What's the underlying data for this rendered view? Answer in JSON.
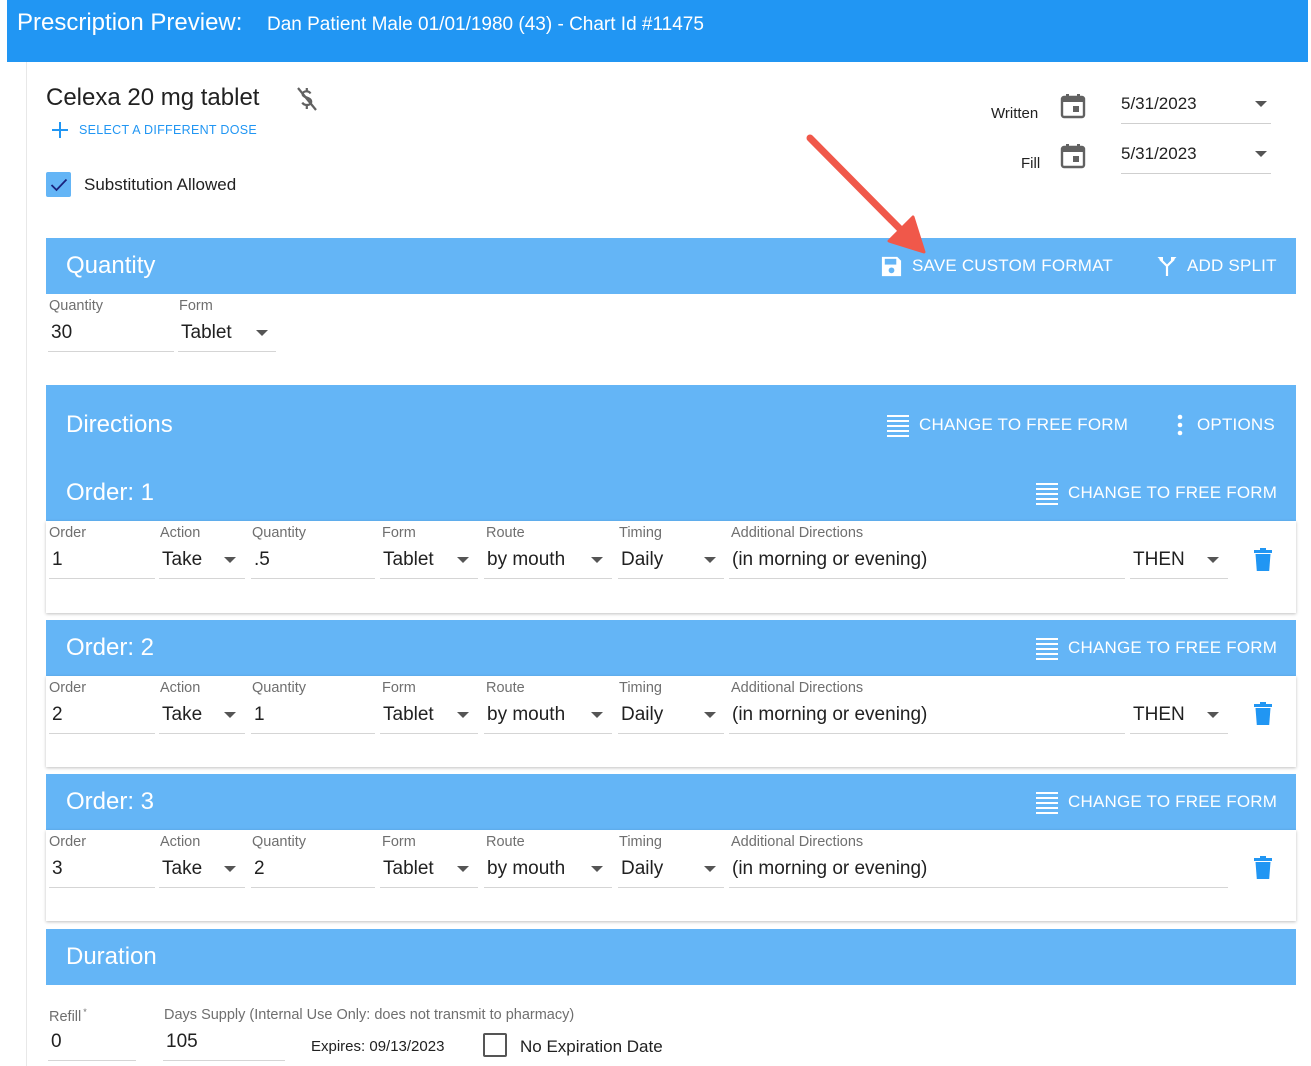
{
  "header": {
    "title": "Prescription Preview:",
    "patient": "Dan Patient Male 01/01/1980 (43) - Chart Id #11475"
  },
  "drug": {
    "name": "Celexa 20 mg tablet",
    "select_dose_label": "SELECT A DIFFERENT DOSE",
    "substitution_label": "Substitution Allowed",
    "substitution_checked": true
  },
  "dates": {
    "written_label": "Written",
    "written_value": "5/31/2023",
    "fill_label": "Fill",
    "fill_value": "5/31/2023"
  },
  "quantity_section": {
    "title": "Quantity",
    "save_custom_label": "SAVE CUSTOM FORMAT",
    "add_split_label": "ADD SPLIT",
    "quantity_label": "Quantity",
    "quantity_value": "30",
    "form_label": "Form",
    "form_value": "Tablet"
  },
  "directions": {
    "title": "Directions",
    "change_free_form_label": "CHANGE TO FREE FORM",
    "options_label": "OPTIONS",
    "column_labels": {
      "order": "Order",
      "action": "Action",
      "quantity": "Quantity",
      "form": "Form",
      "route": "Route",
      "timing": "Timing",
      "additional": "Additional Directions"
    },
    "orders": [
      {
        "title": "Order: 1",
        "change_label": "CHANGE TO FREE FORM",
        "order": "1",
        "action": "Take",
        "quantity": ".5",
        "form": "Tablet",
        "route": "by mouth",
        "timing": "Daily",
        "additional": "(in morning or evening)",
        "then": "THEN"
      },
      {
        "title": "Order: 2",
        "change_label": "CHANGE TO FREE FORM",
        "order": "2",
        "action": "Take",
        "quantity": "1",
        "form": "Tablet",
        "route": "by mouth",
        "timing": "Daily",
        "additional": "(in morning or evening)",
        "then": "THEN"
      },
      {
        "title": "Order: 3",
        "change_label": "CHANGE TO FREE FORM",
        "order": "3",
        "action": "Take",
        "quantity": "2",
        "form": "Tablet",
        "route": "by mouth",
        "timing": "Daily",
        "additional": "(in morning or evening)",
        "then": ""
      }
    ]
  },
  "duration": {
    "title": "Duration",
    "refill_label": "Refill",
    "refill_required_mark": "*",
    "refill_value": "0",
    "days_supply_label": "Days Supply (Internal Use Only: does not transmit to pharmacy)",
    "days_supply_value": "105",
    "expires_text": "Expires: 09/13/2023",
    "no_expiration_label": "No Expiration Date",
    "no_expiration_checked": false
  },
  "colors": {
    "primary": "#2196f3",
    "section_header": "#64b5f6",
    "arrow": "#f0584a"
  }
}
